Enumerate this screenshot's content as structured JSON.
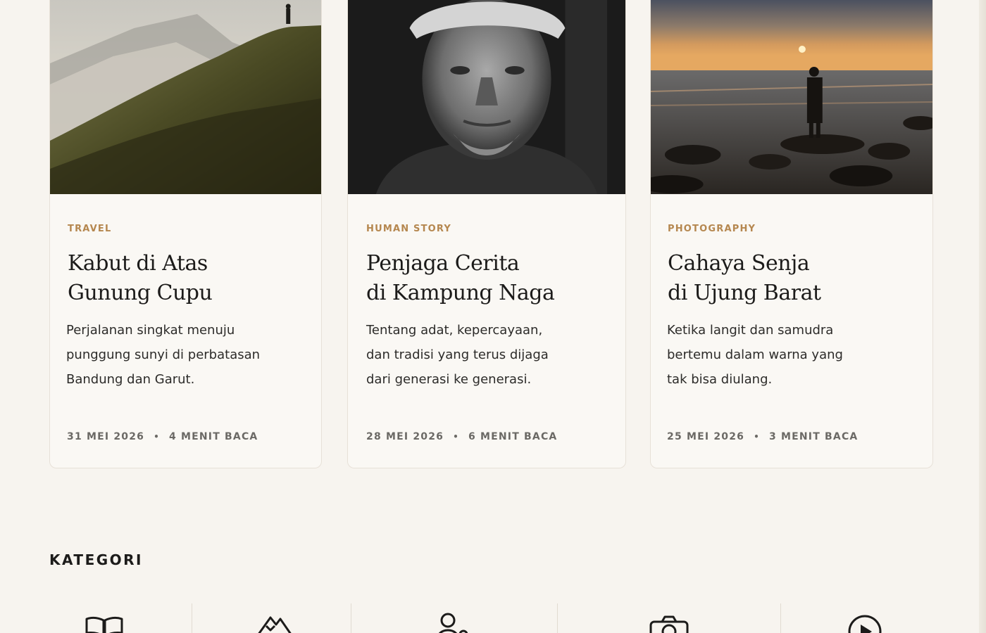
{
  "cards": [
    {
      "category": "TRAVEL",
      "title": "Kabut di Atas\nGunung Cupu",
      "excerpt": "Perjalanan singkat menuju\npunggung sunyi di perbatasan\nBandung dan Garut.",
      "date": "31 MEI 2026",
      "read_time": "4 MENIT BACA"
    },
    {
      "category": "HUMAN STORY",
      "title": "Penjaga Cerita\ndi Kampung Naga",
      "excerpt": "Tentang adat, kepercayaan,\ndan tradisi yang terus dijaga\ndari generasi ke generasi.",
      "date": "28 MEI 2026",
      "read_time": "6 MENIT BACA"
    },
    {
      "category": "PHOTOGRAPHY",
      "title": "Cahaya Senja\ndi Ujung Barat",
      "excerpt": "Ketika langit dan samudra\nbertemu dalam warna yang\ntak bisa diulang.",
      "date": "25 MEI 2026",
      "read_time": "3 MENIT BACA"
    }
  ],
  "meta_separator": "•",
  "categories_section": {
    "title": "KATEGORI",
    "icons": [
      "book-icon",
      "mountain-icon",
      "people-icon",
      "camera-icon",
      "play-icon"
    ]
  },
  "colors": {
    "background": "#f7f4ef",
    "card": "#faf8f4",
    "accent": "#b5874f",
    "text": "#1c1b1a",
    "muted": "#6b6965"
  }
}
